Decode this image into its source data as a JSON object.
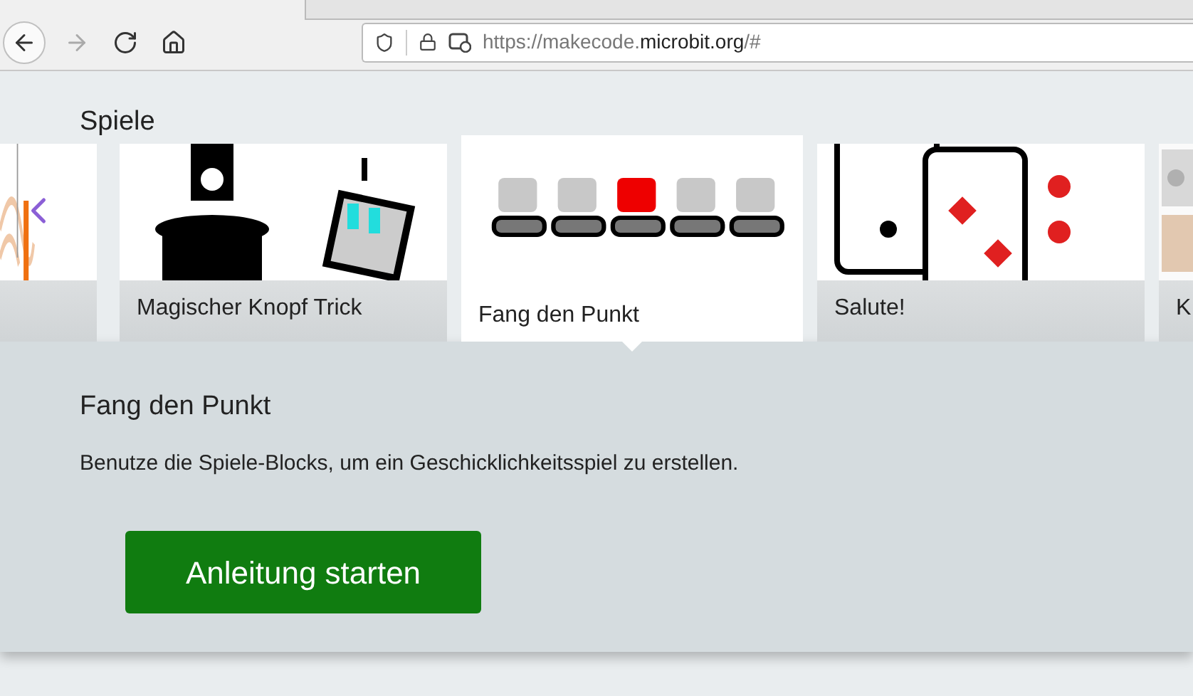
{
  "browser": {
    "nav": [
      {
        "kind": "back",
        "disabled": false
      },
      {
        "kind": "forward",
        "disabled": true
      },
      {
        "kind": "reload",
        "disabled": false
      },
      {
        "kind": "home",
        "disabled": false
      }
    ],
    "url": {
      "prefix": "https://makecode.",
      "domain": "microbit.org",
      "suffix": "/#"
    }
  },
  "section": {
    "title": "Spiele"
  },
  "cards": [
    {
      "selected": false
    },
    {
      "title": "Magischer Knopf Trick",
      "selected": false
    },
    {
      "title": "Fang den Punkt",
      "selected": true
    },
    {
      "title": "Salute!",
      "selected": false
    },
    {
      "title": "K",
      "selected": false
    }
  ],
  "details": {
    "title": "Fang den Punkt",
    "description": "Benutze die Spiele-Blocks, um ein Geschicklichkeitsspiel zu erstellen.",
    "button": "Anleitung starten"
  }
}
